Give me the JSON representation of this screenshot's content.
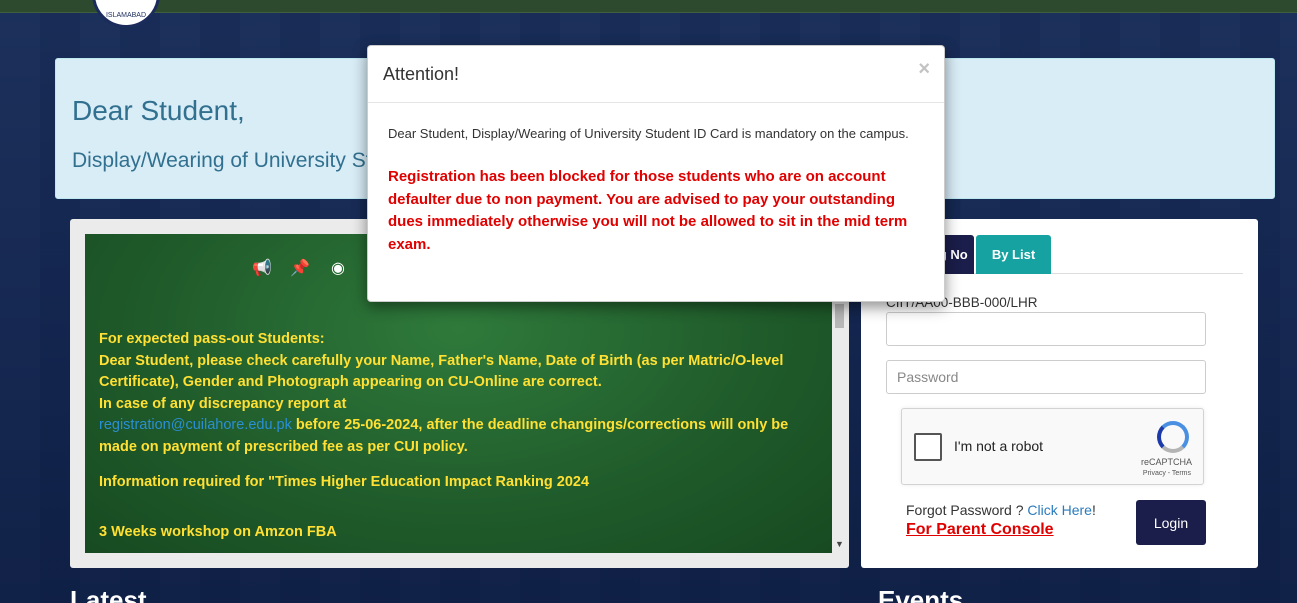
{
  "header": {
    "logo_text": "ISLAMABAD"
  },
  "notice": {
    "greeting": "Dear Student,",
    "message": "Display/Wearing of University Student ID Card is mandatory on the campus."
  },
  "news": {
    "lines": [
      "For expected pass-out Students:",
      "Dear Student, please check carefully your Name, Father's Name, Date of Birth (as per Matric/O-level Certificate), Gender and Photograph appearing on CU-Online are correct.",
      "In case of any discrepancy report at"
    ],
    "email": "registration@cuilahore.edu.pk",
    "deadline_text": " before 25-06-2024, after the deadline changings/corrections will only be made on payment of prescribed fee as per CUI policy.",
    "item2": "Information required for \"Times Higher Education Impact Ranking 2024",
    "item3": "3 Weeks workshop on Amzon FBA"
  },
  "login": {
    "tabs": [
      {
        "label": "Reg No"
      },
      {
        "label": "By List"
      }
    ],
    "reg_hint": "CIIT/AA00-BBB-000/LHR",
    "username_value": "",
    "password_placeholder": "Password",
    "captcha": {
      "label": "I'm not a robot",
      "brand": "reCAPTCHA",
      "terms": "Privacy - Terms"
    },
    "forgot_text": "Forgot Password ? ",
    "forgot_link": "Click Here",
    "forgot_suffix": "!",
    "parent_console": "For Parent Console",
    "login_button": "Login"
  },
  "sections": {
    "latest": "Latest",
    "events": "Events"
  },
  "modal": {
    "title": "Attention!",
    "close": "×",
    "message": "Dear Student, Display/Wearing of University Student ID Card is mandatory on the campus.",
    "alert": "Registration has been blocked for those students who are on account defaulter due to non payment. You are advised to pay your outstanding dues immediately otherwise you will not be allowed to sit in the mid term exam."
  },
  "colors": {
    "accent_navy": "#1b1d4a",
    "accent_teal": "#17a2a2",
    "alert_red": "#e00000",
    "notice_blue": "#31708f",
    "board_text": "#ffe033"
  }
}
